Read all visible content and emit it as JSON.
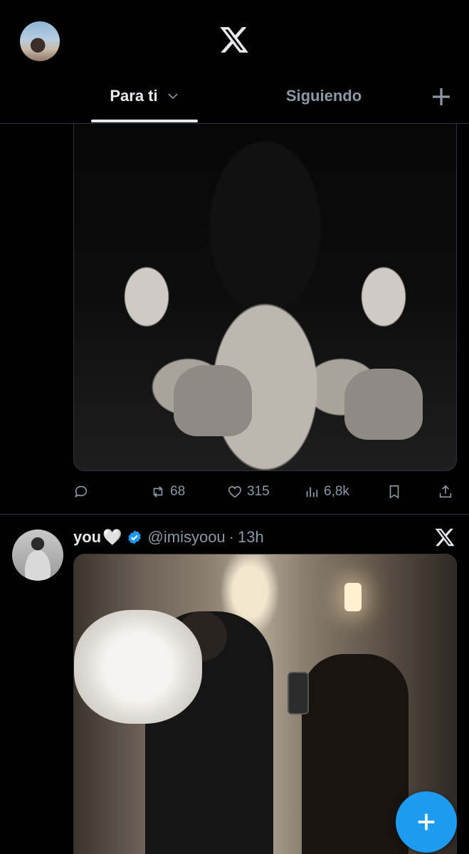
{
  "header": {
    "tabs": [
      {
        "label": "Para ti",
        "active": true
      },
      {
        "label": "Siguiendo",
        "active": false
      }
    ]
  },
  "post1": {
    "stats": {
      "replies": "",
      "reposts": "68",
      "likes": "315",
      "views": "6,8k"
    }
  },
  "post2": {
    "display_name": "you",
    "emoji": "🤍",
    "handle": "@imisyoou",
    "separator": "·",
    "time": "13h"
  },
  "colors": {
    "accent": "#1d9bf0",
    "background": "#000000",
    "muted": "#8b98a5",
    "text": "#e7e9ea",
    "divider": "#2f3336"
  },
  "icons": {
    "top_avatar": "user-avatar",
    "logo": "x-logo",
    "add_tab": "plus-icon",
    "reply": "reply-icon",
    "repost": "repost-icon",
    "like": "heart-icon",
    "views": "views-icon",
    "bookmark": "bookmark-icon",
    "share": "share-icon",
    "verified": "verified-badge-icon",
    "compose": "compose-plus-icon"
  }
}
